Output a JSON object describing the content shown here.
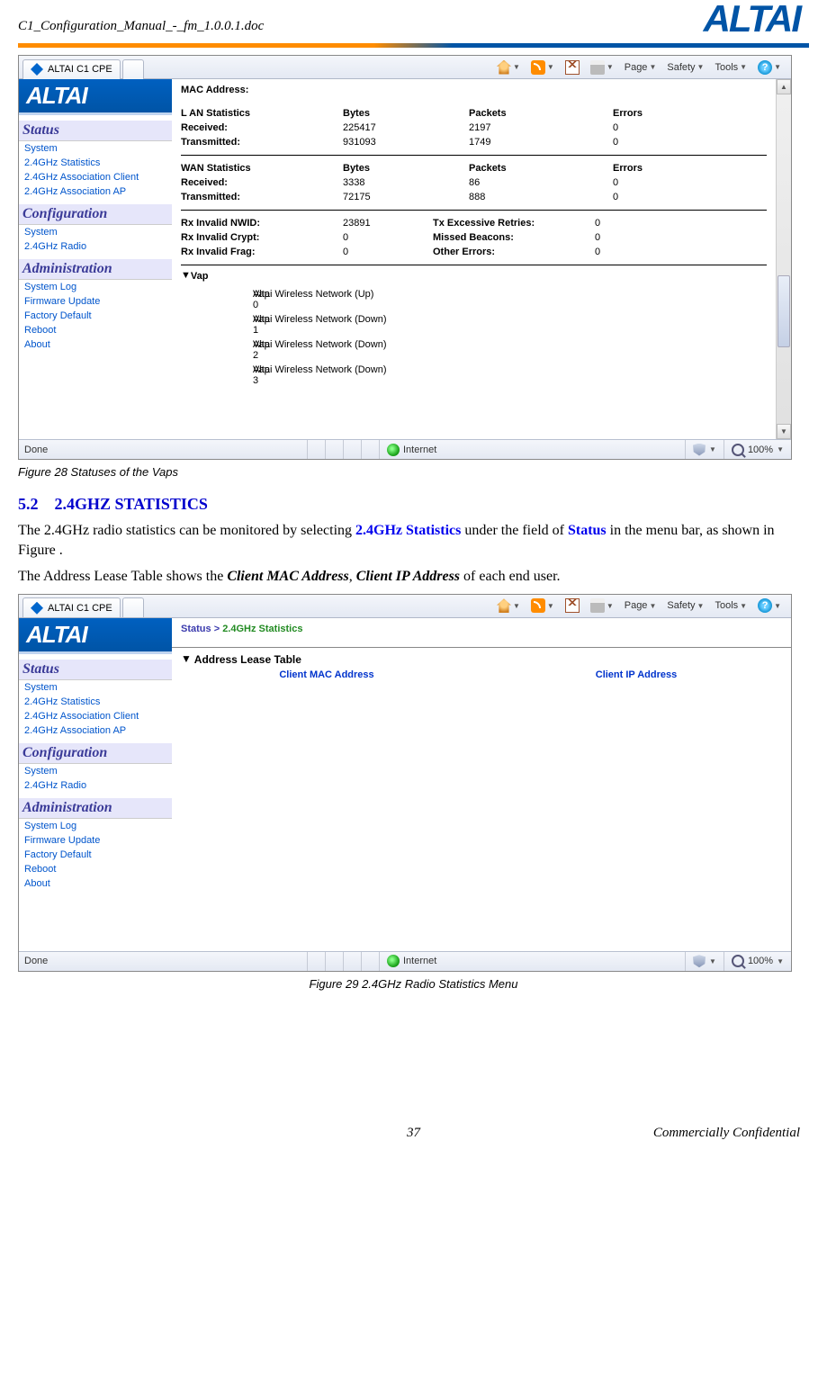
{
  "doc": {
    "header_title": "C1_Configuration_Manual_-_fm_1.0.0.1.doc",
    "brand": "ALTAI"
  },
  "toolbar": {
    "tab_title": "ALTAI C1 CPE",
    "page": "Page",
    "safety": "Safety",
    "tools": "Tools",
    "help_glyph": "?"
  },
  "nav": {
    "status": {
      "head": "Status",
      "items": [
        "System",
        "2.4GHz Statistics",
        "2.4GHz Association Client",
        "2.4GHz Association AP"
      ]
    },
    "config": {
      "head": "Configuration",
      "items": [
        "System",
        "2.4GHz Radio"
      ]
    },
    "admin": {
      "head": "Administration",
      "items": [
        "System Log",
        "Firmware Update",
        "Factory Default",
        "Reboot",
        "About"
      ]
    }
  },
  "shot1": {
    "mac_label": "MAC Address:",
    "lan": {
      "title": "L AN Statistics",
      "cols": [
        "Bytes",
        "Packets",
        "Errors"
      ],
      "received_label": "Received:",
      "transmitted_label": "Transmitted:",
      "received": [
        "225417",
        "2197",
        "0"
      ],
      "transmitted": [
        "931093",
        "1749",
        "0"
      ]
    },
    "wan": {
      "title": "WAN Statistics",
      "cols": [
        "Bytes",
        "Packets",
        "Errors"
      ],
      "received_label": "Received:",
      "transmitted_label": "Transmitted:",
      "received": [
        "3338",
        "86",
        "0"
      ],
      "transmitted": [
        "72175",
        "888",
        "0"
      ]
    },
    "rx": {
      "rx_nwid_label": "Rx Invalid NWID:",
      "rx_nwid_val": "23891",
      "tx_retries_label": "Tx Excessive Retries:",
      "tx_retries_val": "0",
      "rx_crypt_label": "Rx Invalid Crypt:",
      "rx_crypt_val": "0",
      "missed_label": "Missed Beacons:",
      "missed_val": "0",
      "rx_frag_label": "Rx Invalid Frag:",
      "rx_frag_val": "0",
      "other_label": "Other Errors:",
      "other_val": "0"
    },
    "vap": {
      "title": "Vap",
      "rows": [
        {
          "name": "Vap 0",
          "status": "Altai Wireless Network (Up)"
        },
        {
          "name": "Vap 1",
          "status": "Altai Wireless Network (Down)"
        },
        {
          "name": "Vap 2",
          "status": "Altai Wireless Network (Down)"
        },
        {
          "name": "Vap 3",
          "status": "Altai Wireless Network (Down)"
        }
      ]
    }
  },
  "status_bar": {
    "done": "Done",
    "zone": "Internet",
    "zoom": "100%"
  },
  "caption1": "Figure 28    Statuses of the Vaps",
  "section": {
    "num": "5.2",
    "title": "2.4GHZ STATISTICS"
  },
  "para1": {
    "pre": "The 2.4GHz radio statistics can be monitored by selecting ",
    "b1": "2.4GHz Statistics",
    "mid": " under the field of ",
    "b2": "Status",
    "post": " in the menu bar, as shown in Figure ."
  },
  "para2": {
    "pre": "The Address Lease Table shows the ",
    "i1": "Client MAC Address",
    "sep": ", ",
    "i2": "Client IP Address",
    "post": " of each end user."
  },
  "shot2": {
    "breadcrumb": {
      "root": "Status",
      "sep": ">",
      "cur": "2.4GHz Statistics"
    },
    "table": {
      "title": "Address Lease Table",
      "col1": "Client MAC Address",
      "col2": "Client IP Address"
    }
  },
  "caption2": "Figure 29    2.4GHz Radio Statistics Menu",
  "footer": {
    "page": "37",
    "conf": "Commercially Confidential"
  }
}
